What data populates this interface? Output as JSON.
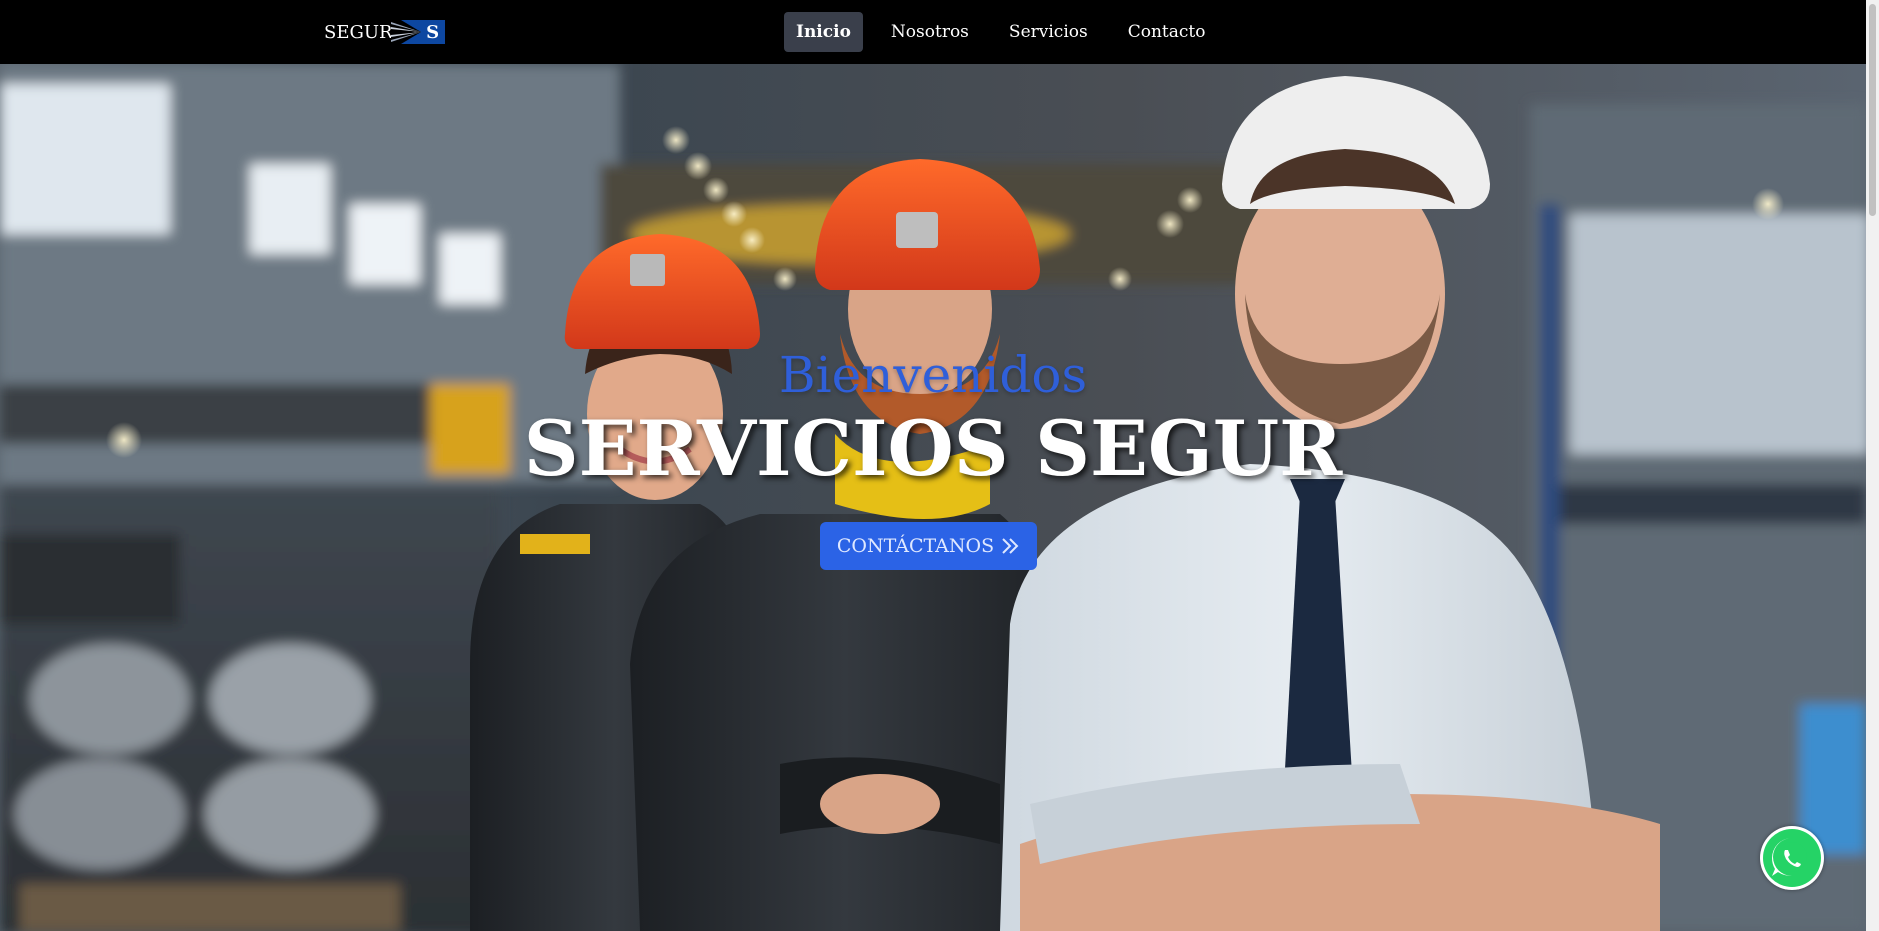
{
  "brand": {
    "text": "SEGUR",
    "mark_letter": "S",
    "mark_color": "#0d47a1"
  },
  "nav": {
    "items": [
      {
        "label": "Inicio",
        "active": true
      },
      {
        "label": "Nosotros",
        "active": false
      },
      {
        "label": "Servicios",
        "active": false
      },
      {
        "label": "Contacto",
        "active": false
      }
    ]
  },
  "hero": {
    "kicker": "Bienvenidos",
    "title": "SERVICIOS SEGUR",
    "cta_label": "CONTÁCTANOS",
    "cta_icon": "double-chevron-right-icon"
  },
  "whatsapp": {
    "icon": "whatsapp-icon",
    "color": "#25d366"
  },
  "colors": {
    "navbar_bg": "#000000",
    "accent": "#2b63e6",
    "kicker": "#2f5fd9",
    "active_nav_bg": "#3a3f4b"
  }
}
